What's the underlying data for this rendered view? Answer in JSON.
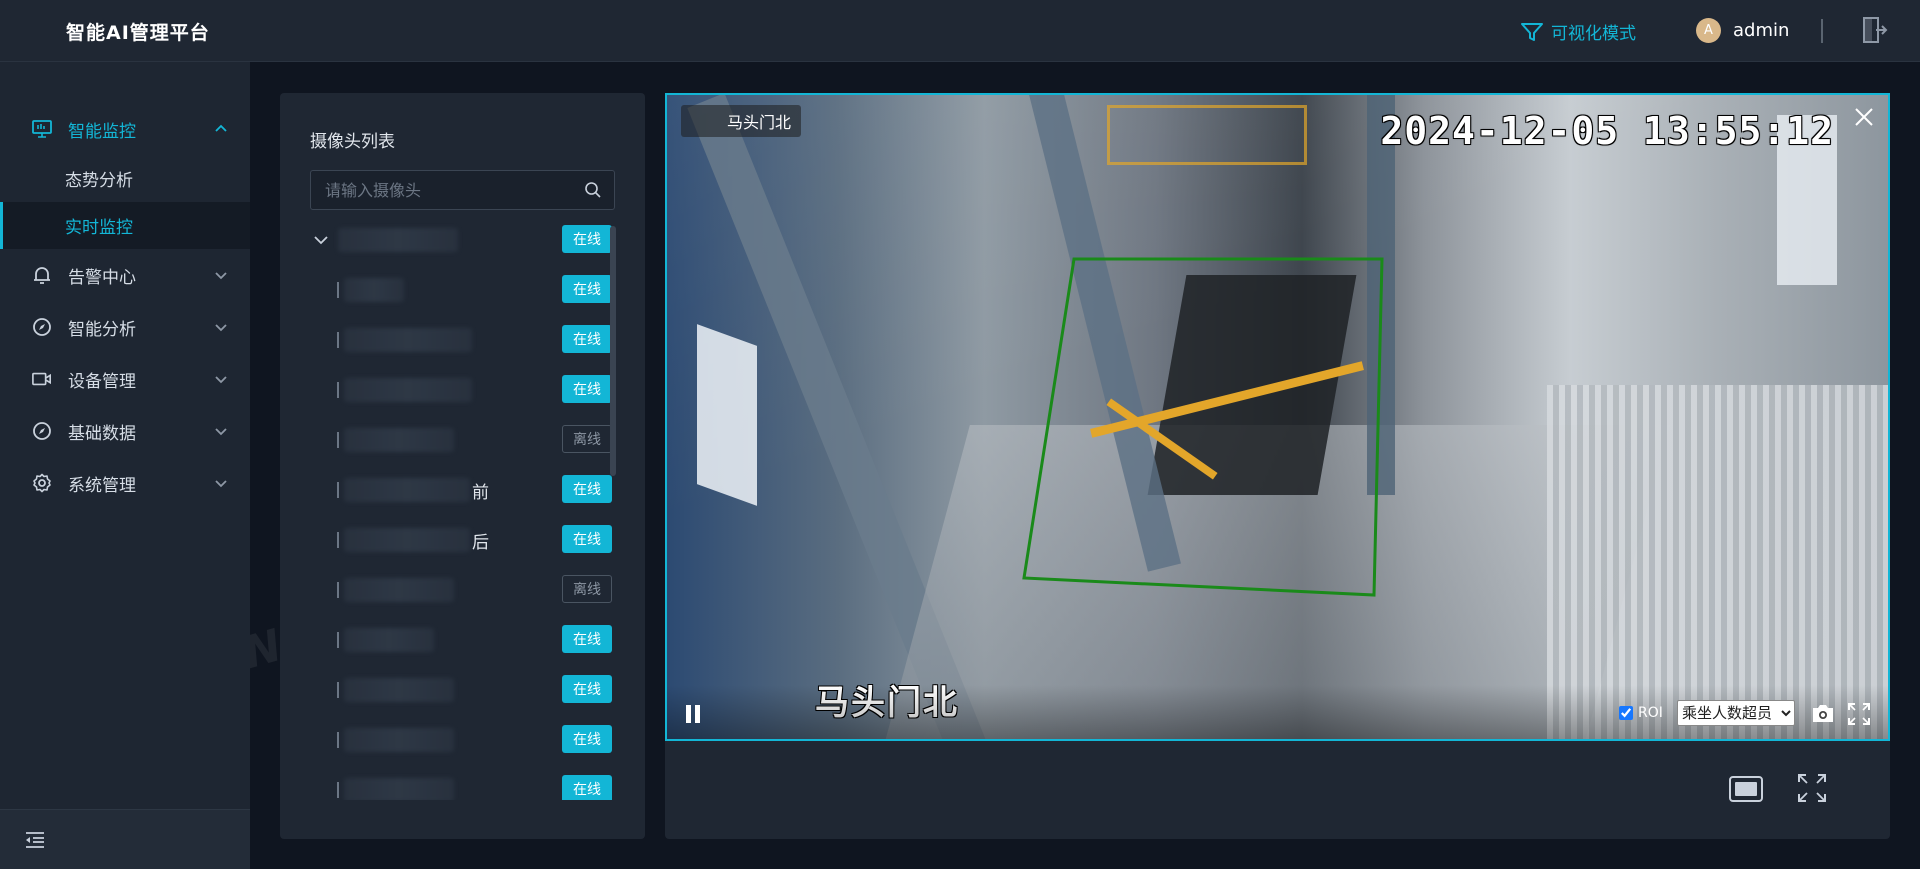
{
  "header": {
    "brand": "智能AI管理平台",
    "vis_mode_label": "可视化模式",
    "user_initial": "A",
    "username": "admin"
  },
  "sidebar": {
    "groups": [
      {
        "label": "智能监控",
        "icon": "monitor-icon",
        "expanded": true
      },
      {
        "label": "告警中心",
        "icon": "bell-icon"
      },
      {
        "label": "智能分析",
        "icon": "compass-icon"
      },
      {
        "label": "设备管理",
        "icon": "camera-icon"
      },
      {
        "label": "基础数据",
        "icon": "compass-icon"
      },
      {
        "label": "系统管理",
        "icon": "gear-icon"
      }
    ],
    "sub_items": [
      {
        "label": "态势分析"
      },
      {
        "label": "实时监控",
        "active": true
      }
    ]
  },
  "camera_list": {
    "title": "摄像头列表",
    "search_placeholder": "请输入摄像头",
    "status_online": "在线",
    "status_offline": "离线",
    "rows": [
      {
        "suffix": "",
        "status": "在线"
      },
      {
        "suffix": "",
        "status": "在线"
      },
      {
        "suffix": "",
        "status": "在线"
      },
      {
        "suffix": "",
        "status": "在线"
      },
      {
        "suffix": "",
        "status": "离线"
      },
      {
        "suffix": "前",
        "status": "在线"
      },
      {
        "suffix": "后",
        "status": "在线"
      },
      {
        "suffix": "",
        "status": "离线"
      },
      {
        "suffix": "",
        "status": "在线"
      },
      {
        "suffix": "",
        "status": "在线"
      },
      {
        "suffix": "",
        "status": "在线"
      },
      {
        "suffix": "",
        "status": "在线"
      }
    ]
  },
  "video": {
    "camera_label": "马头门北",
    "timestamp": "2024-12-05 13:55:12",
    "osd_name": "马头门北",
    "roi_label": "ROI",
    "roi_checked": true,
    "algorithm_selected": "乘坐人数超员"
  },
  "watermark": "TSINGSEE 青犀视频",
  "colors": {
    "accent": "#13b6d6",
    "roi_box": "#1a8a1a",
    "header_bg": "#1f2733",
    "page_bg": "#0f1520"
  }
}
